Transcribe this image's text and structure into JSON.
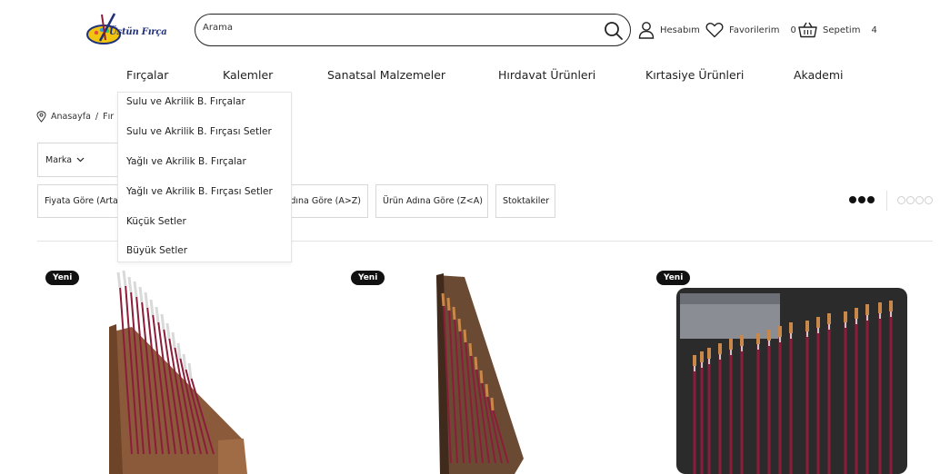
{
  "header": {
    "logo_text": "Üstün Fırça",
    "search_placeholder": "Arama",
    "account_label": "Hesabım",
    "favorites_label": "Favorilerim",
    "favorites_count": "0",
    "cart_label": "Sepetim",
    "cart_count": "4"
  },
  "nav": {
    "items": [
      "Fırçalar",
      "Kalemler",
      "Sanatsal Malzemeler",
      "Hırdavat Ürünleri",
      "Kırtasiye Ürünleri",
      "Akademi"
    ]
  },
  "dropdown": {
    "items": [
      "Sulu ve Akrilik B. Fırçalar",
      "Sulu ve Akrilik B. Fırçası Setler",
      "Yağlı ve Akrilik B. Fırçalar",
      "Yağlı ve Akrilik B. Fırçası Setler",
      "Küçük Setler",
      "Büyük Setler"
    ]
  },
  "breadcrumb": {
    "home": "Anasayfa",
    "separator": "/",
    "current": "Fır"
  },
  "filters": {
    "brand_label": "Marka",
    "sort_options": [
      "Fiyata Göre (Artan)",
      "Ürün Adına Göre (A>Z)",
      "Ürün Adına Göre (Z<A)",
      "Stoktakiler"
    ]
  },
  "products": [
    {
      "badge": "Yeni"
    },
    {
      "badge": "Yeni"
    },
    {
      "badge": "Yeni"
    }
  ],
  "colors": {
    "brush_handle": "#8c1d3a",
    "wood": "#8a5a3a",
    "badge": "#111111"
  }
}
